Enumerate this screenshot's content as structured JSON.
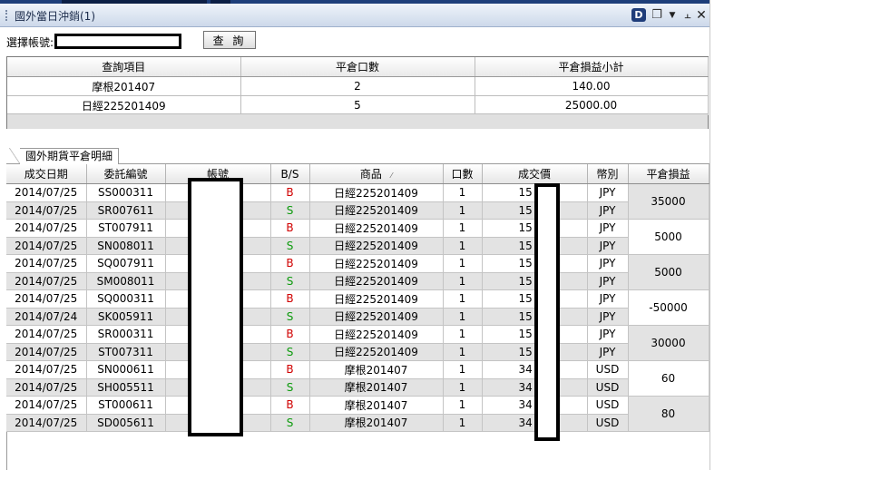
{
  "window": {
    "title": "國外當日沖銷(1)",
    "d_icon_label": "D"
  },
  "query": {
    "account_label": "選擇帳號:",
    "account_value": "",
    "button_label": "查 詢"
  },
  "summary": {
    "headers": [
      "查詢項目",
      "平倉口數",
      "平倉損益小計"
    ],
    "rows": [
      [
        "摩根201407",
        "2",
        "140.00"
      ],
      [
        "日經225201409",
        "5",
        "25000.00"
      ]
    ]
  },
  "detail": {
    "tab_label": "國外期貨平倉明細",
    "headers": [
      "成交日期",
      "委託編號",
      "帳號",
      "B/S",
      "商品",
      "口數",
      "成交價",
      "幣別",
      "平倉損益"
    ],
    "rows": [
      {
        "date": "2014/07/25",
        "order": "SS000311",
        "bs": "B",
        "product": "日經225201409",
        "qty": "1",
        "price": "15",
        "cur": "JPY"
      },
      {
        "date": "2014/07/25",
        "order": "SR007611",
        "bs": "S",
        "product": "日經225201409",
        "qty": "1",
        "price": "15",
        "cur": "JPY"
      },
      {
        "date": "2014/07/25",
        "order": "ST007911",
        "bs": "B",
        "product": "日經225201409",
        "qty": "1",
        "price": "15",
        "cur": "JPY"
      },
      {
        "date": "2014/07/25",
        "order": "SN008011",
        "bs": "S",
        "product": "日經225201409",
        "qty": "1",
        "price": "15",
        "cur": "JPY"
      },
      {
        "date": "2014/07/25",
        "order": "SQ007911",
        "bs": "B",
        "product": "日經225201409",
        "qty": "1",
        "price": "15",
        "cur": "JPY"
      },
      {
        "date": "2014/07/25",
        "order": "SM008011",
        "bs": "S",
        "product": "日經225201409",
        "qty": "1",
        "price": "15",
        "cur": "JPY"
      },
      {
        "date": "2014/07/25",
        "order": "SQ000311",
        "bs": "B",
        "product": "日經225201409",
        "qty": "1",
        "price": "15",
        "cur": "JPY"
      },
      {
        "date": "2014/07/24",
        "order": "SK005911",
        "bs": "S",
        "product": "日經225201409",
        "qty": "1",
        "price": "15",
        "cur": "JPY"
      },
      {
        "date": "2014/07/25",
        "order": "SR000311",
        "bs": "B",
        "product": "日經225201409",
        "qty": "1",
        "price": "15",
        "cur": "JPY"
      },
      {
        "date": "2014/07/25",
        "order": "ST007311",
        "bs": "S",
        "product": "日經225201409",
        "qty": "1",
        "price": "15",
        "cur": "JPY"
      },
      {
        "date": "2014/07/25",
        "order": "SN000611",
        "bs": "B",
        "product": "摩根201407",
        "qty": "1",
        "price": "34",
        "cur": "USD"
      },
      {
        "date": "2014/07/25",
        "order": "SH005511",
        "bs": "S",
        "product": "摩根201407",
        "qty": "1",
        "price": "34",
        "cur": "USD"
      },
      {
        "date": "2014/07/25",
        "order": "ST000611",
        "bs": "B",
        "product": "摩根201407",
        "qty": "1",
        "price": "34",
        "cur": "USD"
      },
      {
        "date": "2014/07/25",
        "order": "SD005611",
        "bs": "S",
        "product": "摩根201407",
        "qty": "1",
        "price": "34",
        "cur": "USD"
      }
    ],
    "pnl": [
      "35000",
      "5000",
      "5000",
      "-50000",
      "30000",
      "60",
      "80"
    ]
  },
  "colors": {
    "buy": "#d00000",
    "sell": "#0c9a0c",
    "title_bar": "#cdd9ea"
  }
}
